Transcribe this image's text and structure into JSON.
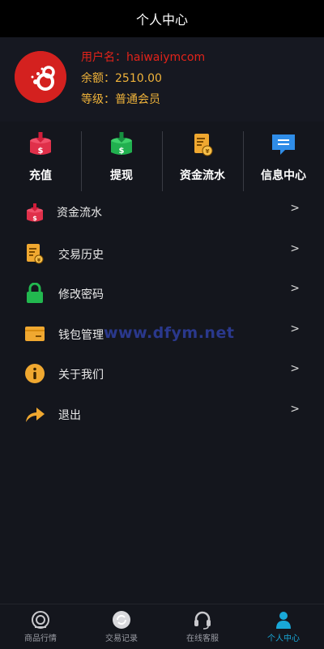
{
  "header": {
    "title": "个人中心"
  },
  "profile": {
    "username_line": "用户名：haiwaiymcom",
    "balance_line": "余额：2510.00",
    "level_line": "等级：普通会员"
  },
  "quick_actions": [
    {
      "label": "充值",
      "icon": "deposit-icon"
    },
    {
      "label": "提现",
      "icon": "withdraw-icon"
    },
    {
      "label": "资金流水",
      "icon": "fund-flow-icon"
    },
    {
      "label": "信息中心",
      "icon": "message-icon"
    }
  ],
  "menu": [
    {
      "label": "资金流水",
      "icon": "fund-flow-icon",
      "arrow": ">"
    },
    {
      "label": "交易历史",
      "icon": "history-icon",
      "arrow": ">"
    },
    {
      "label": "修改密码",
      "icon": "lock-icon",
      "arrow": ">"
    },
    {
      "label": "钱包管理",
      "icon": "wallet-icon",
      "arrow": ">"
    },
    {
      "label": "关于我们",
      "icon": "info-icon",
      "arrow": ">"
    },
    {
      "label": "退出",
      "icon": "share-icon",
      "arrow": ">"
    }
  ],
  "watermark": "www.dfym.net",
  "tabbar": [
    {
      "label": "商品行情",
      "icon": "market-icon"
    },
    {
      "label": "交易记录",
      "icon": "records-icon"
    },
    {
      "label": "在线客服",
      "icon": "headset-icon"
    },
    {
      "label": "个人中心",
      "icon": "user-icon",
      "active": true
    }
  ],
  "colors": {
    "accent": "#19a8d8",
    "username": "#e2231a",
    "gold": "#f0b33a",
    "background": "#14161d"
  }
}
